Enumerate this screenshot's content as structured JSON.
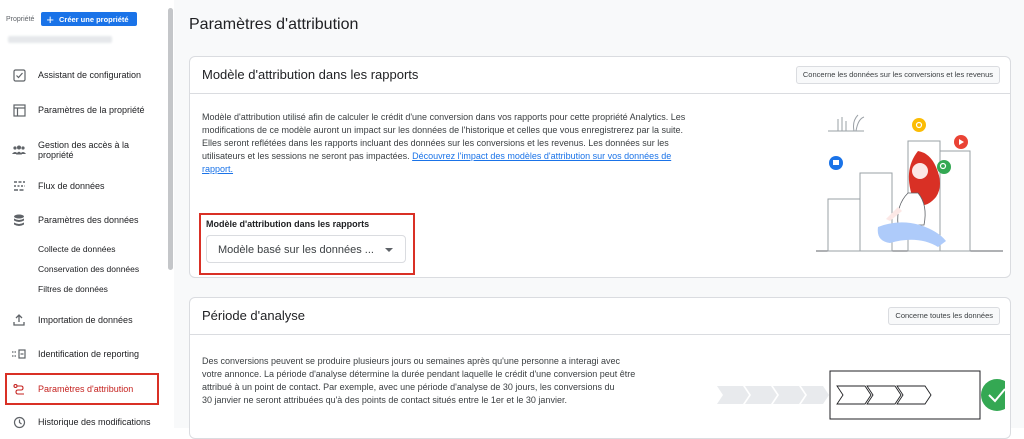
{
  "sidebar": {
    "property_label": "Propriété",
    "create_button": "Créer une propriété",
    "items": [
      {
        "label": "Assistant de configuration",
        "icon": "checkbox-icon"
      },
      {
        "label": "Paramètres de la propriété",
        "icon": "layout-icon"
      },
      {
        "label": "Gestion des accès à la propriété",
        "icon": "people-icon"
      },
      {
        "label": "Flux de données",
        "icon": "data-streams-icon"
      },
      {
        "label": "Paramètres des données",
        "icon": "database-icon"
      }
    ],
    "sub_items": [
      "Collecte de données",
      "Conservation des données",
      "Filtres de données"
    ],
    "items_bottom": [
      {
        "label": "Importation de données",
        "icon": "upload-icon"
      },
      {
        "label": "Identification de reporting",
        "icon": "reporting-id-icon"
      },
      {
        "label": "Paramètres d'attribution",
        "icon": "attribution-icon"
      },
      {
        "label": "Historique des modifications",
        "icon": "history-icon"
      }
    ]
  },
  "main": {
    "title": "Paramètres d'attribution",
    "card1": {
      "title": "Modèle d'attribution dans les rapports",
      "badge": "Concerne les données sur les conversions et les revenus",
      "lines": [
        "Modèle d'attribution utilisé afin de calculer le crédit d'une conversion dans vos rapports pour cette propriété Analytics. Les",
        "modifications de ce modèle auront un impact sur les données de l'historique et celles que vous enregistrerez par la suite.",
        "Elles seront reflétées dans les rapports incluant des données sur les conversions et les revenus. Les données sur les",
        "utilisateurs et les sessions ne seront pas impactées."
      ],
      "link_part1": "Découvrez l'impact des modèles d'attribution sur vos données de",
      "link_part2": "rapport.",
      "field_label": "Modèle d'attribution dans les rapports",
      "field_value": "Modèle basé sur les données ..."
    },
    "card2": {
      "title": "Période d'analyse",
      "badge": "Concerne toutes les données",
      "lines": [
        "Des conversions peuvent se produire plusieurs jours ou semaines après qu'une personne a interagi avec",
        "votre annonce. La période d'analyse détermine la durée pendant laquelle le crédit d'une conversion peut être",
        "attribué à un point de contact. Par exemple, avec une période d'analyse de 30 jours, les conversions du",
        "30 janvier ne seront attribuées qu'à des points de contact situés entre le 1er et le 30 janvier."
      ]
    }
  },
  "colors": {
    "accent": "#1a73e8",
    "highlight": "#d93025",
    "success": "#34a853"
  }
}
